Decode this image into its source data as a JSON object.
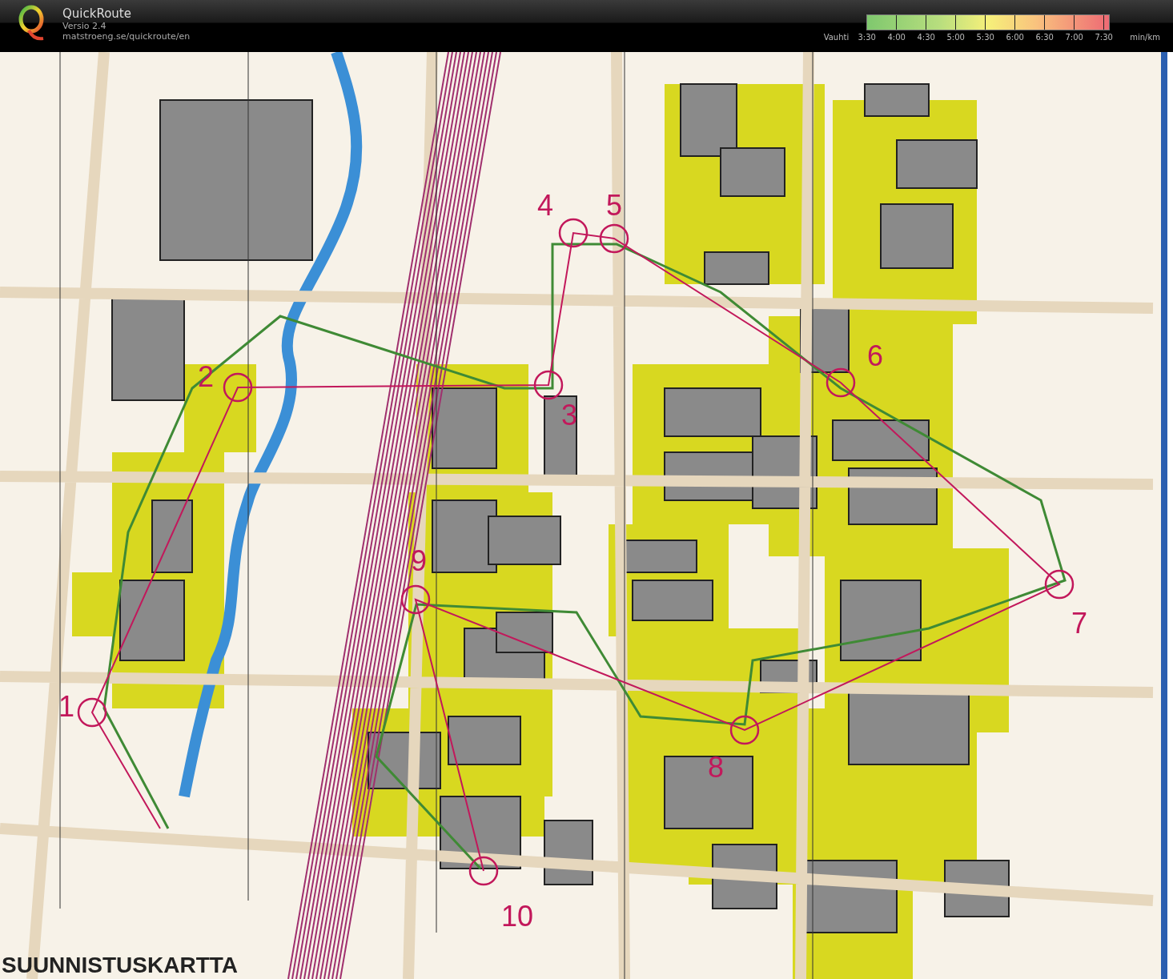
{
  "app": {
    "title": "QuickRoute",
    "version": "Versio 2.4",
    "url": "matstroeng.se/quickroute/en"
  },
  "pace_legend": {
    "label": "Vauhti",
    "ticks": [
      "3:30",
      "4:00",
      "4:30",
      "5:00",
      "5:30",
      "6:00",
      "6:30",
      "7:00",
      "7:30"
    ],
    "unit": "min/km"
  },
  "map": {
    "title": "SUUNNISTUSKARTTA",
    "controls": [
      {
        "label": "1"
      },
      {
        "label": "2"
      },
      {
        "label": "3"
      },
      {
        "label": "4"
      },
      {
        "label": "5"
      },
      {
        "label": "6"
      },
      {
        "label": "7"
      },
      {
        "label": "8"
      },
      {
        "label": "9"
      },
      {
        "label": "10"
      }
    ]
  }
}
